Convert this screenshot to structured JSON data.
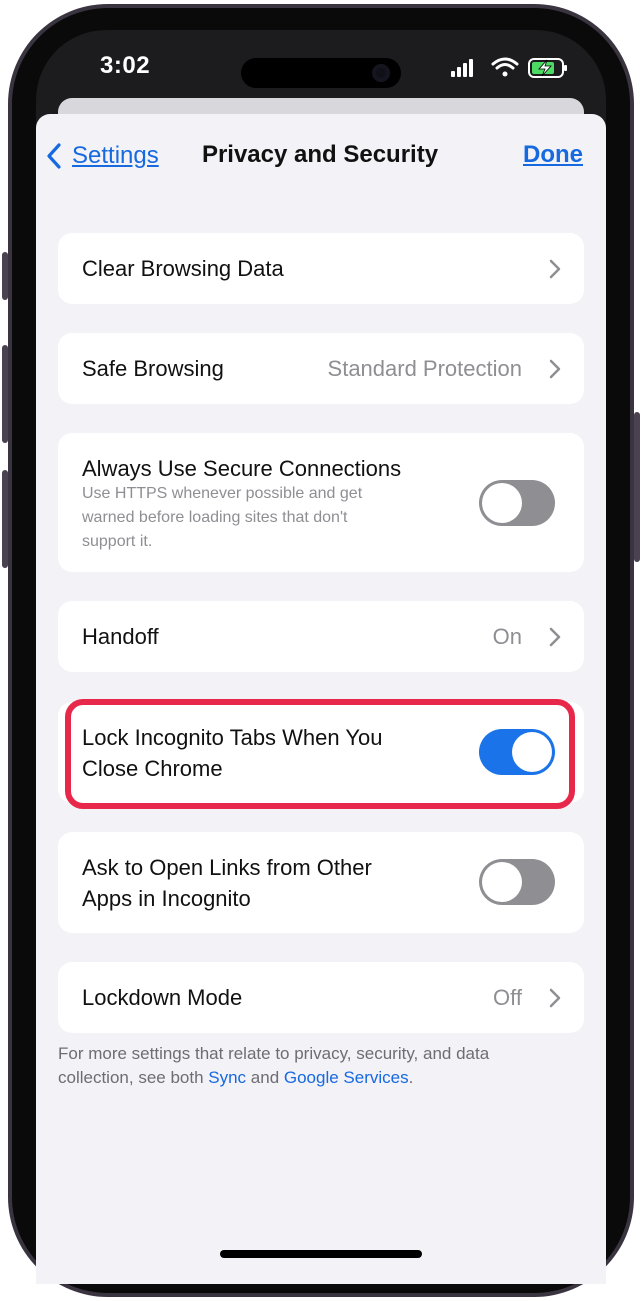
{
  "status_bar": {
    "time": "3:02"
  },
  "nav": {
    "back_label": "Settings",
    "title": "Privacy and Security",
    "done_label": "Done"
  },
  "rows": {
    "clear_browsing": {
      "label": "Clear Browsing Data"
    },
    "safe_browsing": {
      "label": "Safe Browsing",
      "value": "Standard Protection"
    },
    "secure_connections": {
      "label": "Always Use Secure Connections",
      "description_lines": [
        "Use HTTPS whenever possible and get",
        "warned before loading sites that don't",
        "support it."
      ],
      "enabled": false
    },
    "handoff": {
      "label": "Handoff",
      "value": "On"
    },
    "lock_incognito": {
      "label_lines": [
        "Lock Incognito Tabs When You",
        "Close Chrome"
      ],
      "enabled": true
    },
    "ask_open_links": {
      "label_lines": [
        "Ask to Open Links from Other",
        "Apps in Incognito"
      ],
      "enabled": false
    },
    "lockdown": {
      "label": "Lockdown Mode",
      "value": "Off"
    }
  },
  "footer": {
    "line1": "For more settings that relate to privacy, security, and data",
    "line2_prefix": "collection, see both ",
    "sync_link": "Sync",
    "and_text": " and ",
    "google_services_link": "Google Services",
    "period": "."
  },
  "colors": {
    "accent": "#1769e0",
    "toggle_on": "#1a73e8",
    "highlight": "#e8284a"
  }
}
